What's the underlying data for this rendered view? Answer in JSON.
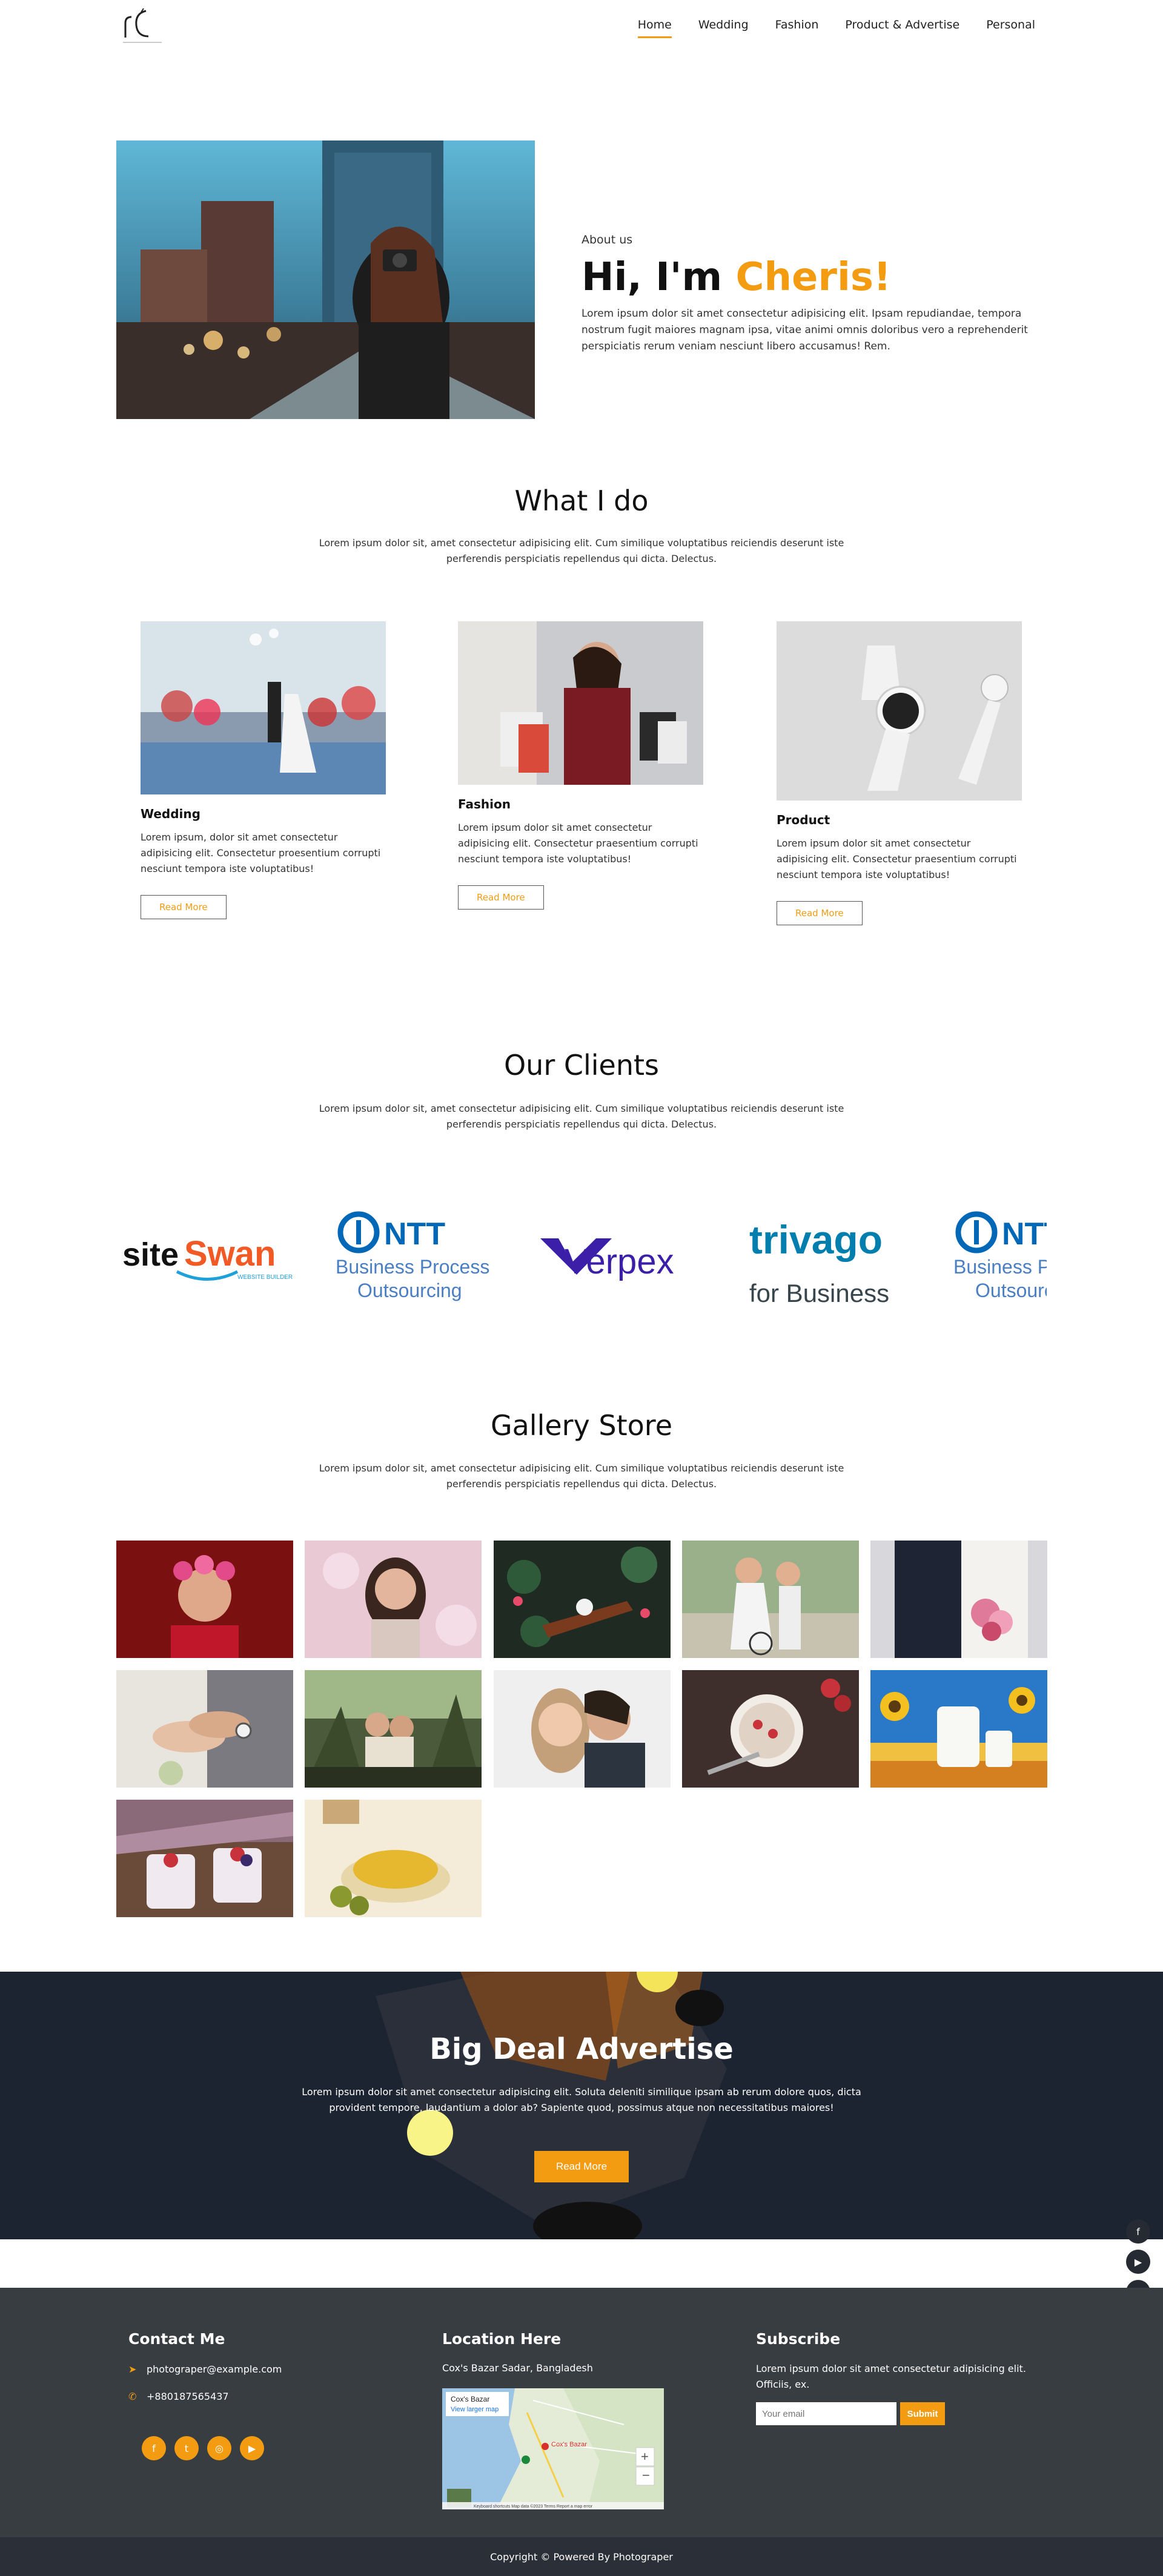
{
  "nav": {
    "items": [
      {
        "label": "Home"
      },
      {
        "label": "Wedding"
      },
      {
        "label": "Fashion"
      },
      {
        "label": "Product & Advertise"
      },
      {
        "label": "Personal"
      }
    ]
  },
  "about": {
    "label": "About us",
    "title_prefix": "Hi, I'm ",
    "title_name": "Cheris!",
    "description": "Lorem ipsum dolor sit amet consectetur adipisicing elit. Ipsam repudiandae, tempora nostrum fugit maiores magnam ipsa, vitae animi omnis doloribus vero a reprehenderit perspiciatis rerum veniam nesciunt libero accusamus! Rem."
  },
  "services": {
    "title": "What I do",
    "subtitle": "Lorem ipsum dolor sit, amet consectetur adipisicing elit. Cum similique voluptatibus reiciendis deserunt iste perferendis perspiciatis repellendus qui dicta. Delectus.",
    "items": [
      {
        "title": "Wedding",
        "description": "Lorem ipsum, dolor sit amet consectetur adipisicing elit. Consectetur proesentium corrupti nesciunt tempora iste voluptatibus!",
        "button": "Read More"
      },
      {
        "title": "Fashion",
        "description": "Lorem ipsum dolor sit amet consectetur adipisicing elit. Consectetur praesentium corrupti nesciunt tempora iste voluptatibus!",
        "button": "Read More"
      },
      {
        "title": "Product",
        "description": "Lorem ipsum dolor sit amet consectetur adipisicing elit. Consectetur praesentium corrupti nesciunt tempora iste voluptatibus!",
        "button": "Read More"
      }
    ]
  },
  "clients": {
    "title": "Our Clients",
    "subtitle": "Lorem ipsum dolor sit, amet consectetur adipisicing elit. Cum similique voluptatibus reiciendis deserunt iste perferendis perspiciatis repellendus qui dicta. Delectus.",
    "logos": [
      {
        "name": "siteSwan",
        "line1": "site",
        "line2": "Swan",
        "tag": "WEBSITE BUILDER"
      },
      {
        "name": "NTT",
        "line1": "NTT",
        "line2": "Business Process",
        "line3": "Outsourcing"
      },
      {
        "name": "Verpex",
        "line1": "Verpex"
      },
      {
        "name": "trivago",
        "line1": "trivago",
        "line2": "for Business"
      },
      {
        "name": "NTT-repeat",
        "line1": "NTT",
        "line2": "Business Pr",
        "line3": "Outsourc"
      }
    ]
  },
  "gallery": {
    "title": "Gallery Store",
    "subtitle": "Lorem ipsum dolor sit, amet consectetur adipisicing elit. Cum similique voluptatibus reiciendis deserunt iste perferendis perspiciatis repellendus qui dicta. Delectus."
  },
  "banner": {
    "title": "Big Deal Advertise",
    "description": "Lorem ipsum dolor sit amet consectetur adipisicing elit. Soluta deleniti similique ipsam ab rerum dolore quos, dicta provident tempore, laudantium a dolor ab? Sapiente quod, possimus atque non necessitatibus maiores!",
    "button": "Read More"
  },
  "footer": {
    "contact": {
      "title": "Contact Me",
      "email": "photograper@example.com",
      "phone": "+880187565437"
    },
    "location": {
      "title": "Location Here",
      "address": "Cox's Bazar Sadar, Bangladesh",
      "map_place": "Cox's Bazar",
      "map_link": "View larger map",
      "map_marker": "Cox's Bazar",
      "map_credits": "Keyboard shortcuts   Map data ©2023   Terms   Report a map error"
    },
    "subscribe": {
      "title": "Subscribe",
      "description": "Lorem ipsum dolor sit amet consectetur adipisicing elit. Officiis, ex.",
      "placeholder": "Your email",
      "button": "Submit"
    }
  },
  "copyright": "Copyright © Powered By Photograper"
}
